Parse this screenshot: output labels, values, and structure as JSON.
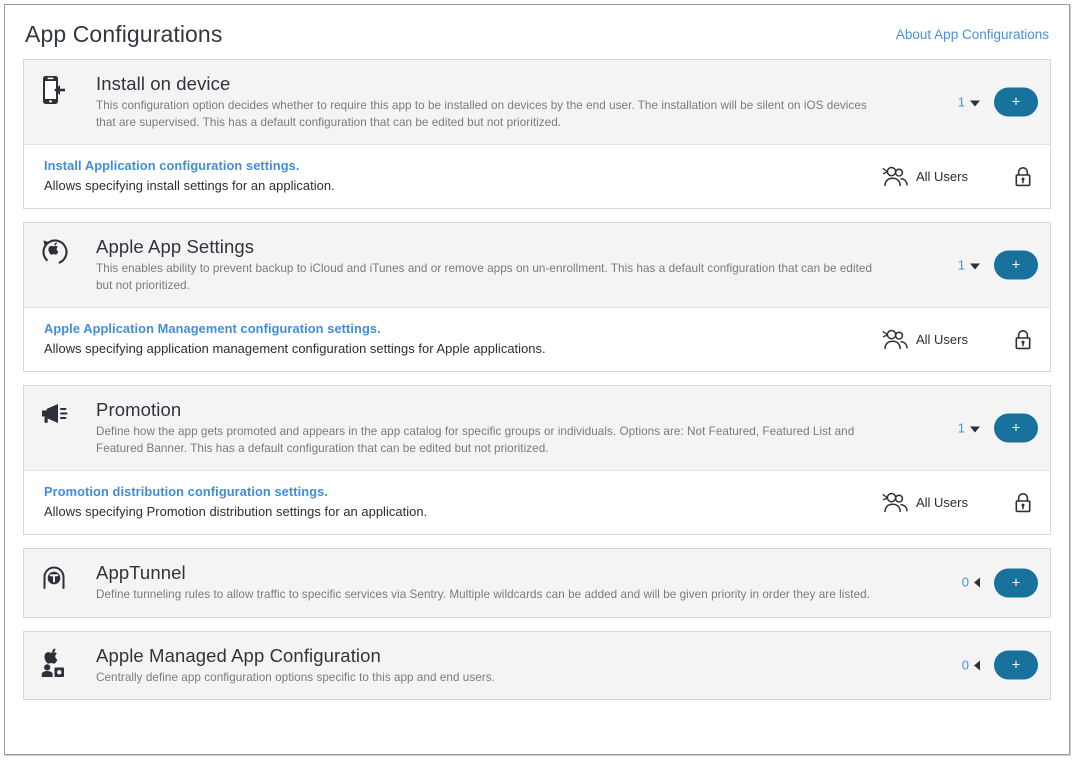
{
  "header": {
    "title": "App Configurations",
    "about_link": "About App Configurations"
  },
  "cards": [
    {
      "icon": "install-on-device-icon",
      "title": "Install on device",
      "description": "This configuration option decides whether to require this app to be installed on devices by the end user. The installation will be silent on iOS devices that are supervised. This has a default configuration that can be edited but not prioritized.",
      "count": "1",
      "expanded": true,
      "add_label": "+",
      "sub": {
        "title": "Install Application configuration settings.",
        "description": "Allows specifying install settings for an application.",
        "audience": "All Users",
        "group_icon": "group-users-icon",
        "lock_icon": "lock-icon"
      }
    },
    {
      "icon": "apple-app-settings-icon",
      "title": "Apple App Settings",
      "description": "This enables ability to prevent backup to iCloud and iTunes and or remove apps on un-enrollment. This has a default configuration that can be edited but not prioritized.",
      "count": "1",
      "expanded": true,
      "add_label": "+",
      "sub": {
        "title": "Apple Application Management configuration settings.",
        "description": "Allows specifying application management configuration settings for Apple applications.",
        "audience": "All Users",
        "group_icon": "group-users-icon",
        "lock_icon": "lock-icon"
      }
    },
    {
      "icon": "promotion-megaphone-icon",
      "title": "Promotion",
      "description": "Define how the app gets promoted and appears in the app catalog for specific groups or individuals. Options are: Not Featured, Featured List and Featured Banner. This has a default configuration that can be edited but not prioritized.",
      "count": "1",
      "expanded": true,
      "add_label": "+",
      "sub": {
        "title": "Promotion distribution configuration settings.",
        "description": "Allows specifying Promotion distribution settings for an application.",
        "audience": "All Users",
        "group_icon": "group-users-icon",
        "lock_icon": "lock-icon"
      }
    },
    {
      "icon": "apptunnel-icon",
      "title": "AppTunnel",
      "description": "Define tunneling rules to allow traffic to specific services via Sentry. Multiple wildcards can be added and will be given priority in order they are listed.",
      "count": "0",
      "expanded": false,
      "add_label": "+",
      "sub": null
    },
    {
      "icon": "apple-managed-app-config-icon",
      "title": "Apple Managed App Configuration",
      "description": "Centrally define app configuration options specific to this app and end users.",
      "count": "0",
      "expanded": false,
      "add_label": "+",
      "sub": null
    }
  ],
  "colors": {
    "accent_blue": "#4a90d9",
    "link_blue": "#3f8ddc",
    "button_blue": "#19729c",
    "header_bg": "#f4f4f4",
    "border": "#d8d8d8",
    "title_text": "#2f333b",
    "desc_text": "#7b7b7b"
  }
}
